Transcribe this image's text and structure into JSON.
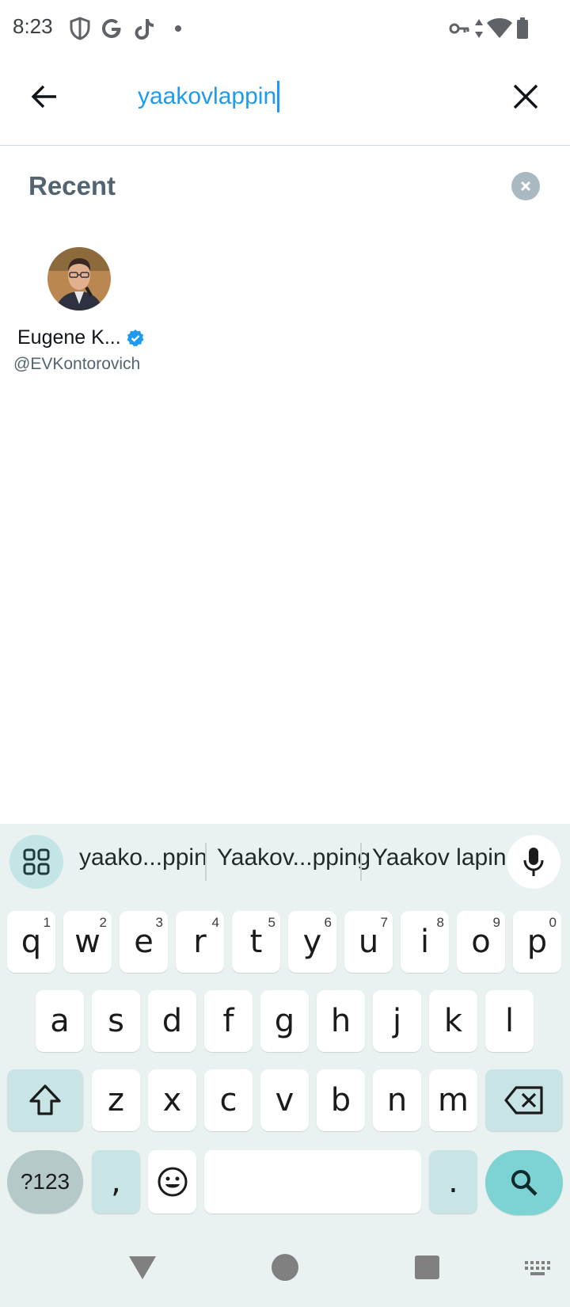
{
  "status_bar": {
    "time": "8:23",
    "left_icons": [
      "shield-icon",
      "google-icon",
      "tiktok-icon",
      "dot-icon"
    ],
    "right_icons": [
      "vpn-key-icon",
      "data-arrows-icon",
      "wifi-icon",
      "battery-icon"
    ]
  },
  "search": {
    "query": "yaakovlappin",
    "back_icon": "arrow-left-icon",
    "clear_icon": "close-icon"
  },
  "recent": {
    "title": "Recent",
    "users": [
      {
        "name": "Eugene K...",
        "handle": "@EVKontorovich",
        "verified": true
      }
    ]
  },
  "keyboard": {
    "suggestions": [
      "yaako...ppin",
      "Yaakov...pping",
      "Yaakov lapin"
    ],
    "row1": [
      {
        "key": "q",
        "hint": "1"
      },
      {
        "key": "w",
        "hint": "2"
      },
      {
        "key": "e",
        "hint": "3"
      },
      {
        "key": "r",
        "hint": "4"
      },
      {
        "key": "t",
        "hint": "5"
      },
      {
        "key": "y",
        "hint": "6"
      },
      {
        "key": "u",
        "hint": "7"
      },
      {
        "key": "i",
        "hint": "8"
      },
      {
        "key": "o",
        "hint": "9"
      },
      {
        "key": "p",
        "hint": "0"
      }
    ],
    "row2": [
      "a",
      "s",
      "d",
      "f",
      "g",
      "h",
      "j",
      "k",
      "l"
    ],
    "row3": [
      "z",
      "x",
      "c",
      "v",
      "b",
      "n",
      "m"
    ],
    "symbols_label": "?123",
    "comma_label": ",",
    "period_label": "."
  },
  "colors": {
    "accent": "#1d9bf0",
    "keyboard_bg": "#eaf1f1",
    "search_key": "#7dd2d3"
  }
}
